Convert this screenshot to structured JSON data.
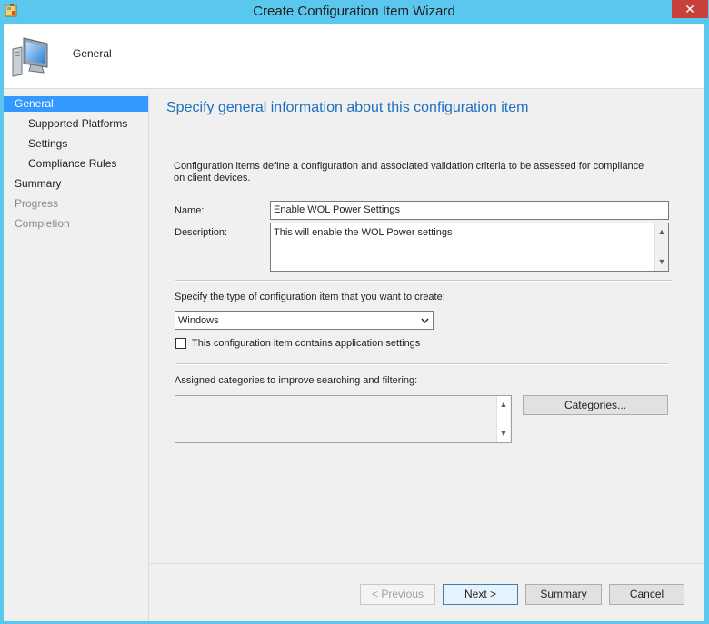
{
  "window": {
    "title": "Create Configuration Item Wizard",
    "close_glyph": "✕"
  },
  "header": {
    "page_title": "General"
  },
  "nav": {
    "items": [
      {
        "label": "General",
        "state": "selected"
      },
      {
        "label": "Supported Platforms",
        "state": "normal"
      },
      {
        "label": "Settings",
        "state": "normal"
      },
      {
        "label": "Compliance Rules",
        "state": "normal"
      },
      {
        "label": "Summary",
        "state": "normal"
      },
      {
        "label": "Progress",
        "state": "disabled"
      },
      {
        "label": "Completion",
        "state": "disabled"
      }
    ]
  },
  "main": {
    "heading": "Specify general information about this configuration item",
    "intro": "Configuration items define a configuration and associated validation criteria to be assessed for compliance on client devices.",
    "name_label": "Name:",
    "name_value": "Enable WOL Power Settings",
    "description_label": "Description:",
    "description_value": "This will enable the WOL Power settings",
    "type_prompt": "Specify the type of configuration item that you want to create:",
    "type_selected": "Windows",
    "app_settings_label": "This configuration item contains application settings",
    "app_settings_checked": false,
    "categories_prompt": "Assigned categories to improve searching and filtering:",
    "categories_button": "Categories..."
  },
  "footer": {
    "previous": "< Previous",
    "next": "Next >",
    "summary": "Summary",
    "cancel": "Cancel"
  },
  "colors": {
    "accent": "#3399ff",
    "heading": "#1e6fbf",
    "titlebar": "#5ac8ee",
    "close": "#c7413a"
  },
  "icons": {
    "app": "wizard-app-icon",
    "header": "computer-monitor-icon",
    "scroll_up": "▲",
    "scroll_down": "▼",
    "dropdown": "chevron-down-icon"
  }
}
